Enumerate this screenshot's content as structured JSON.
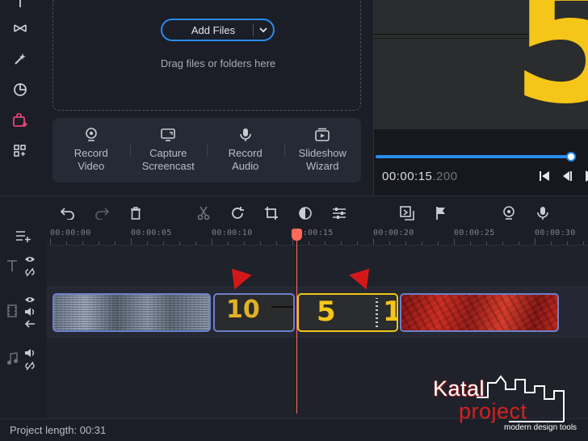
{
  "import_panel": {
    "add_files_label": "Add Files",
    "drag_hint": "Drag files or folders here",
    "actions": [
      {
        "label": "Record\nVideo",
        "icon": "webcam-icon"
      },
      {
        "label": "Capture\nScreencast",
        "icon": "monitor-icon"
      },
      {
        "label": "Record\nAudio",
        "icon": "microphone-icon"
      },
      {
        "label": "Slideshow\nWizard",
        "icon": "slideshow-icon"
      }
    ]
  },
  "rail": {
    "icons": [
      "text-icon",
      "transitions-icon",
      "effects-icon",
      "stickers-icon",
      "import-icon",
      "more-tools-icon"
    ],
    "active": "import-icon",
    "active_color": "#e8437a"
  },
  "preview": {
    "frame_digit": "5",
    "timecode_main": "00:00:15",
    "timecode_ms": ".200",
    "progress_percent": 97
  },
  "toolbar": {
    "icons": [
      "undo-icon",
      "redo-icon",
      "delete-icon",
      "cut-icon",
      "rotate-icon",
      "crop-icon",
      "color-adjust-icon",
      "clip-properties-icon",
      "fit-icon",
      "marker-flag-icon",
      "record-webcam-icon",
      "record-voice-icon"
    ]
  },
  "ruler": {
    "ticks": [
      "00:00:00",
      "00:00:05",
      "00:00:10",
      "00:00:15",
      "00:00:20",
      "00:00:25",
      "00:00:30"
    ]
  },
  "clips": {
    "clip2_text": "10",
    "clip3_text": "5",
    "clip3_text_b": "1"
  },
  "status": {
    "project_length": "Project length: 00:31"
  },
  "watermark": {
    "line1": "Katal",
    "line2": "project",
    "line3": "modern design tools"
  },
  "colors": {
    "accent": "#2a8cf0",
    "playhead": "#ff6a5c",
    "selected_clip": "#f0c419",
    "marker": "#d4181a"
  }
}
